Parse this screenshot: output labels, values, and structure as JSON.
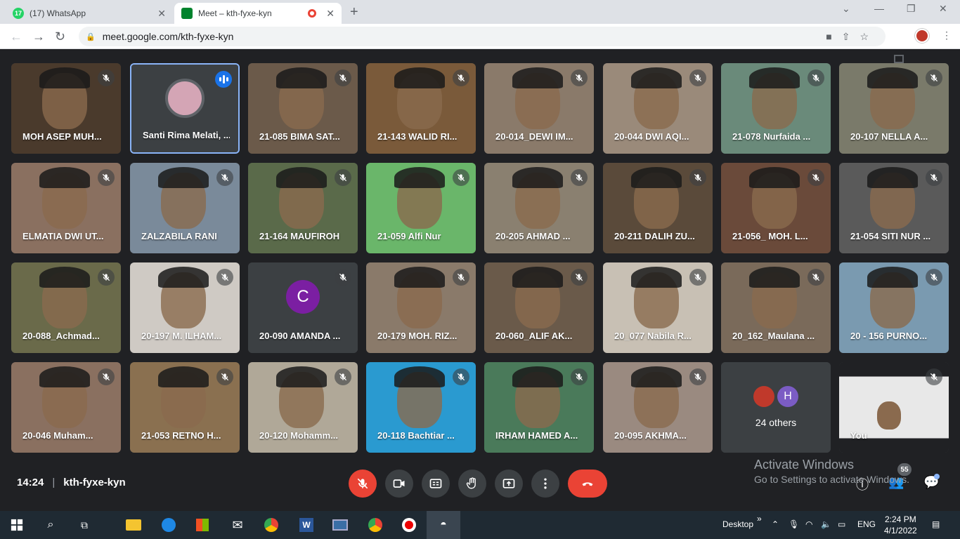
{
  "browser": {
    "tabs": [
      {
        "title": "(17) WhatsApp",
        "badge": "17",
        "favicon": "whatsapp-icon"
      },
      {
        "title": "Meet – kth-fyxe-kyn",
        "favicon": "google-meet-icon"
      }
    ],
    "url": "meet.google.com/kth-fyxe-kyn"
  },
  "participants": [
    {
      "name": "MOH ASEP MUH...",
      "bg": "#4a3a2c"
    },
    {
      "name": "Santi Rima Melati, ...",
      "bg": "#3c4043",
      "speaking": true
    },
    {
      "name": "21-085 BIMA SAT...",
      "bg": "#6b5a4a"
    },
    {
      "name": "21-143 WALID RI...",
      "bg": "#7a5a3a"
    },
    {
      "name": "20-014_DEWI IM...",
      "bg": "#8a7a6a"
    },
    {
      "name": "20-044 DWI AQI...",
      "bg": "#9a8a7a"
    },
    {
      "name": "21-078 Nurfaida ...",
      "bg": "#6a8a7a"
    },
    {
      "name": "20-107 NELLA A...",
      "bg": "#7a7a6a"
    },
    {
      "name": "ELMATIA DWI UT...",
      "bg": "#8a7060"
    },
    {
      "name": "ZALZABILA RANI",
      "bg": "#7a8a9a"
    },
    {
      "name": "21-164 MAUFIROH",
      "bg": "#5a6a4a"
    },
    {
      "name": "21-059 Alfi Nur",
      "bg": "#6ab66a"
    },
    {
      "name": "20-205 AHMAD ...",
      "bg": "#8a8070"
    },
    {
      "name": "20-211 DALIH ZU...",
      "bg": "#5a4a3a"
    },
    {
      "name": "21-056_ MOH. L...",
      "bg": "#6a4a3a"
    },
    {
      "name": "21-054 SITI NUR ...",
      "bg": "#5a5a5a"
    },
    {
      "name": "20-088_Achmad...",
      "bg": "#6a6a4a"
    },
    {
      "name": "20-197 M. ILHAM...",
      "bg": "#cfcac4"
    },
    {
      "name": "20-090 AMANDA ...",
      "bg": "#3c4043",
      "avatar_letter": "C"
    },
    {
      "name": "20-179 MOH. RIZ...",
      "bg": "#8a7a6a"
    },
    {
      "name": "20-060_ALIF AK...",
      "bg": "#6a5a4a"
    },
    {
      "name": "20_077 Nabila R...",
      "bg": "#c8c0b4"
    },
    {
      "name": "20_162_Maulana ...",
      "bg": "#7a6a5a"
    },
    {
      "name": "20 - 156 PURNO...",
      "bg": "#7a9ab0"
    },
    {
      "name": "20-046 Muham...",
      "bg": "#8a7060"
    },
    {
      "name": "21-053 RETNO H...",
      "bg": "#8a7050"
    },
    {
      "name": "20-120 Mohamm...",
      "bg": "#b0a898"
    },
    {
      "name": "20-118 Bachtiar ...",
      "bg": "#2a9ad0"
    },
    {
      "name": "IRHAM HAMED A...",
      "bg": "#4a7a5a"
    },
    {
      "name": "20-095 AKHMA...",
      "bg": "#9a8a80"
    },
    {
      "name": "",
      "bg": "#3c4043",
      "others": true
    },
    {
      "name": "You",
      "bg": "#e8e8e8"
    }
  ],
  "others": {
    "count_label": "24 others",
    "avatar_letter": "H"
  },
  "meeting": {
    "time": "14:24",
    "code": "kth-fyxe-kyn",
    "participant_count": "55"
  },
  "watermark": {
    "line1": "Activate Windows",
    "line2": "Go to Settings to activate Windows."
  },
  "taskbar": {
    "desktop_label": "Desktop",
    "lang": "ENG",
    "time": "2:24 PM",
    "date": "4/1/2022"
  },
  "colors": {
    "accent": "#8ab4f8",
    "leave_red": "#ea4335",
    "meet_bg": "#202124"
  }
}
